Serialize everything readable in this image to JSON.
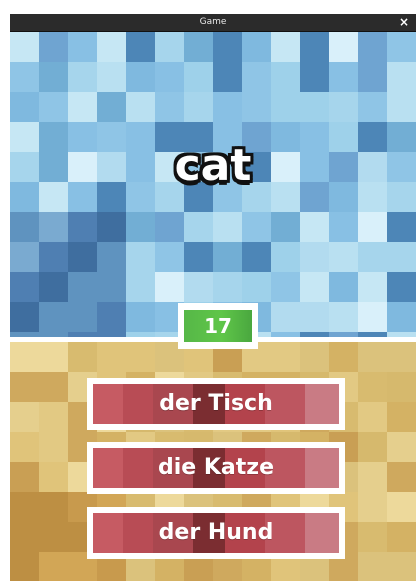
{
  "window": {
    "title": "Game",
    "close_icon": "×"
  },
  "game": {
    "prompt_word": "cat",
    "counter": "17",
    "answers": [
      {
        "label": "der Tisch"
      },
      {
        "label": "die Katze"
      },
      {
        "label": "der Hund"
      }
    ]
  },
  "colors": {
    "sky": "#9fd0e8",
    "sand": "#dbc27c",
    "counter_green": "#5fc649",
    "answer_red": "#b84c55"
  }
}
